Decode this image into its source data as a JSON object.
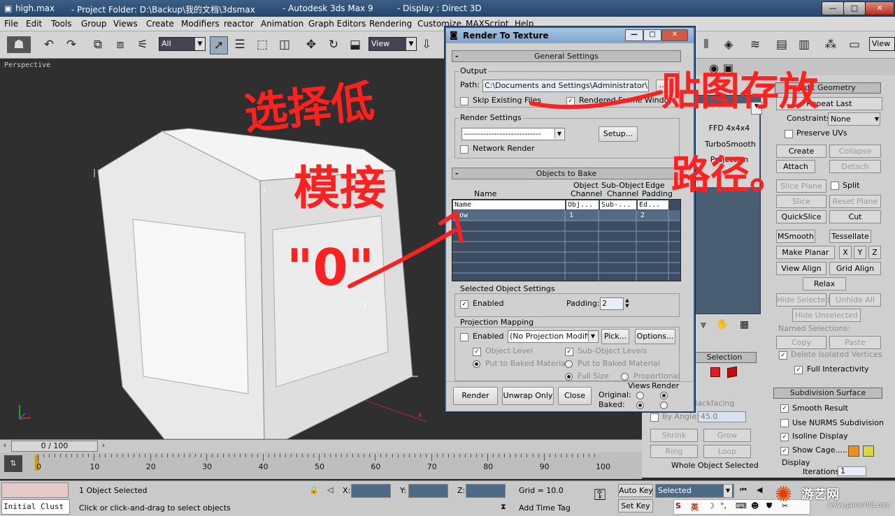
{
  "window": {
    "file_title": "high.max",
    "project_folder": "- Project Folder: D:\\Backup\\我的文档\\3dsmax",
    "app_name": "- Autodesk 3ds Max 9",
    "display": "- Display : Direct 3D",
    "btn_min": "—",
    "btn_max": "□",
    "btn_close": "✕"
  },
  "menu": [
    "File",
    "Edit",
    "Tools",
    "Group",
    "Views",
    "Create",
    "Modifiers",
    "reactor",
    "Animation",
    "Graph Editors",
    "Rendering",
    "Customize",
    "MAXScript",
    "Help"
  ],
  "toolbar": {
    "selection_filter": "All",
    "ref_coord": "View",
    "view_right": "View"
  },
  "viewport": {
    "label": "Perspective",
    "axis_z": "z",
    "axis_y": "y",
    "axis_x": "x"
  },
  "dialog": {
    "title": "Render To Texture",
    "general_settings": "General Settings",
    "output_label": "Output",
    "path_label": "Path:",
    "path_value": "C:\\Documents and Settings\\Administrator\\桌面",
    "browse": "...",
    "skip_existing": "Skip Existing Files",
    "rendered_frame_window": "Rendered Frame Window",
    "render_settings_label": "Render Settings",
    "render_settings_value": "----------------------------",
    "setup": "Setup...",
    "network_render": "Network Render",
    "objects_to_bake": "Objects to Bake",
    "col_name": "Name",
    "col_object_channel": [
      "Object",
      "Channel"
    ],
    "col_subobject_channel": [
      "Sub-Object",
      "Channel"
    ],
    "col_edge_padding": [
      "Edge",
      "Padding"
    ],
    "table_headers": [
      "Name",
      "Obj...",
      "Sub-...",
      "Ed..."
    ],
    "table_rows": [
      {
        "name": "low",
        "obj": "1",
        "sub": "",
        "ed": "2"
      }
    ],
    "selected_object_settings": "Selected Object Settings",
    "enabled": "Enabled",
    "padding_label": "Padding:",
    "padding_value": "2",
    "projection_mapping": "Projection Mapping",
    "projection_modifier": "(No Projection Modifier",
    "pick": "Pick...",
    "options": "Options...",
    "object_level": "Object Level",
    "sub_object_levels": "Sub-Object Levels",
    "put_to_baked_material": "Put to Baked Material",
    "put_to_baked_material_2": "Put to Baked Material",
    "full_size": "Full Size",
    "proportional": "Proportional",
    "render": "Render",
    "unwrap_only": "Unwrap Only",
    "close": "Close",
    "views_label": "Views",
    "render_col": "Render",
    "original_label": "Original:",
    "baked_label": "Baked:"
  },
  "cmdpanel": {
    "edit_geometry": "Edit Geometry",
    "repeat_last": "Repeat Last",
    "constraints_label": "Constraints:",
    "constraints_value": "None",
    "preserve_uvs": "Preserve UVs",
    "create": "Create",
    "collapse": "Collapse",
    "attach": "Attach",
    "detach": "Detach",
    "slice_plane": "Slice Plane",
    "split": "Split",
    "slice": "Slice",
    "reset_plane": "Reset Plane",
    "quickslice": "QuickSlice",
    "cut": "Cut",
    "msmooth": "MSmooth",
    "tessellate": "Tessellate",
    "make_planar": "Make Planar",
    "x": "X",
    "y": "Y",
    "z": "Z",
    "view_align": "View Align",
    "grid_align": "Grid Align",
    "relax": "Relax",
    "hide_selected": "Hide Selected",
    "unhide_all": "Unhide All",
    "hide_unselected": "Hide Unselected",
    "named_selections": "Named Selections:",
    "copy": "Copy",
    "paste": "Paste",
    "delete_isolated": "Delete Isolated Vertices",
    "full_interactivity": "Full Interactivity",
    "subdivision_surface": "Subdivision Surface",
    "smooth_result": "Smooth Result",
    "use_nurms": "Use NURMS Subdivision",
    "isoline_display": "Isoline Display",
    "show_cage": "Show Cage......",
    "display_label": "Display",
    "iterations_label": "Iterations:",
    "iterations_value": "1",
    "mod_ffd": "FFD 4x4x4",
    "mod_turbosmooth": "TurboSmooth",
    "mod_projection": "Projection",
    "selection_label": "Selection",
    "by_angle": "By Angle:",
    "by_angle_value": "45.0",
    "backfacing": "Backfacing",
    "shrink": "Shrink",
    "grow": "Grow",
    "ring": "Ring",
    "loop": "Loop",
    "whole_object_selected": "Whole Object Selected",
    "cage_color_1": "#f0901a",
    "cage_color_2": "#d8d838"
  },
  "timeline": {
    "frame_display": "0 / 100",
    "ticks": [
      "0",
      "10",
      "20",
      "30",
      "40",
      "50",
      "60",
      "70",
      "80",
      "90",
      "100"
    ]
  },
  "status": {
    "initial_clust": "Initial Clust",
    "objects_selected": "1 Object Selected",
    "prompt": "Click or click-and-drag to select objects",
    "x_label": "X:",
    "y_label": "Y:",
    "z_label": "Z:",
    "grid": "Grid = 10.0",
    "add_time_tag": "Add Time Tag",
    "auto_key": "Auto Key",
    "set_key": "Set Key",
    "selected_value": "Selected",
    "ime_label": "英"
  },
  "annotation": {
    "line1": "选择低",
    "line2": "模接",
    "line3": "\"0\"",
    "line4": "贴图存放",
    "line5": "路径。",
    "color": "#ff2020"
  },
  "watermark": {
    "brand": "游艺网",
    "url": "www.game798.com"
  }
}
